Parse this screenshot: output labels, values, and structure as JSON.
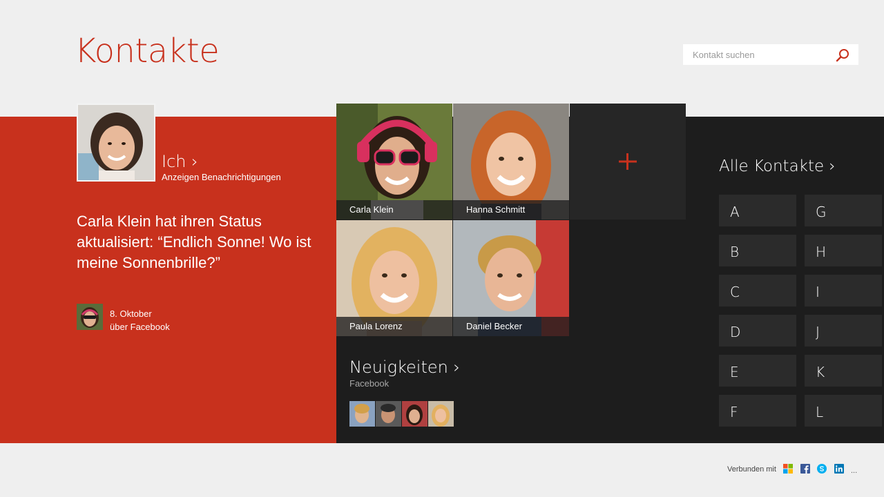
{
  "app": {
    "title": "Kontakte"
  },
  "search": {
    "placeholder": "Kontakt suchen"
  },
  "me": {
    "label": "Ich ›",
    "notifications": "Anzeigen Benachrichtigungen",
    "status_text": "Carla Klein hat ihren Status aktualisiert: “Endlich Sonne! Wo ist meine Sonnenbrille?”",
    "status_date": "8. Oktober",
    "status_source": "über Facebook"
  },
  "favorites": [
    {
      "name": "Carla Klein"
    },
    {
      "name": "Hanna Schmitt"
    },
    {
      "name": "Paula Lorenz"
    },
    {
      "name": "Daniel Becker"
    }
  ],
  "news": {
    "title": "Neuigkeiten ›",
    "source": "Facebook"
  },
  "all_contacts": {
    "title": "Alle Kontakte ›",
    "letters": [
      "A",
      "B",
      "C",
      "D",
      "E",
      "F",
      "G",
      "H",
      "I",
      "J",
      "K",
      "L"
    ]
  },
  "footer": {
    "connected_label": "Verbunden mit",
    "more": "..."
  },
  "colors": {
    "accent": "#c8311d",
    "dark": "#1d1d1d",
    "tile": "#2b2b2b"
  },
  "icons": [
    "search-icon",
    "add-contact-icon",
    "windows-icon",
    "facebook-icon",
    "skype-icon",
    "linkedin-icon"
  ]
}
